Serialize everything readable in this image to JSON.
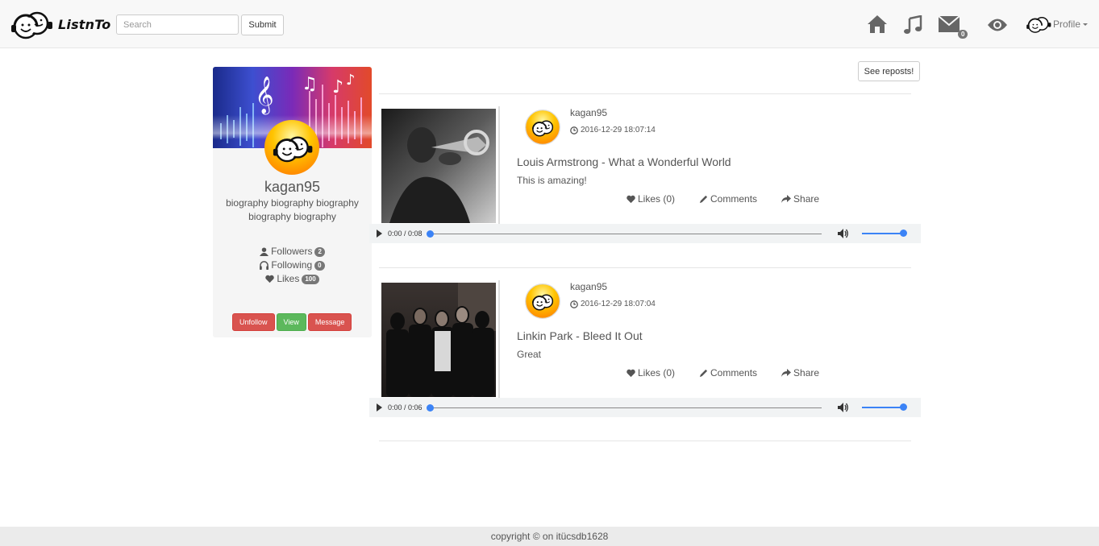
{
  "navbar": {
    "brand": "ListnTo",
    "search_placeholder": "Search",
    "submit_label": "Submit",
    "messages_count": "0",
    "profile_label": "Profile"
  },
  "profile": {
    "username": "kagan95",
    "bio": "biography biography biography biography biography",
    "followers_label": "Followers",
    "followers_count": "2",
    "following_label": "Following",
    "following_count": "0",
    "likes_label": "Likes",
    "likes_count": "100",
    "unfollow_label": "Unfollow",
    "view_label": "View",
    "message_label": "Message"
  },
  "feed": {
    "reposts_label": "See reposts!",
    "posts": [
      {
        "user": "kagan95",
        "timestamp": "2016-12-29 18:07:14",
        "title": "Louis Armstrong - What a Wonderful World",
        "comment": "This is amazing!",
        "likes_label": "Likes (0)",
        "comments_label": "Comments",
        "share_label": "Share",
        "player_time": "0:00 / 0:08"
      },
      {
        "user": "kagan95",
        "timestamp": "2016-12-29 18:07:04",
        "title": "Linkin Park - Bleed It Out",
        "comment": "Great",
        "likes_label": "Likes (0)",
        "comments_label": "Comments",
        "share_label": "Share",
        "player_time": "0:00 / 0:06"
      }
    ]
  },
  "footer": {
    "text": "copyright © on itücsdb1628"
  },
  "colors": {
    "danger": "#d9534f",
    "success": "#5cb85c",
    "accent": "#3b83f6",
    "badge": "#777777"
  }
}
